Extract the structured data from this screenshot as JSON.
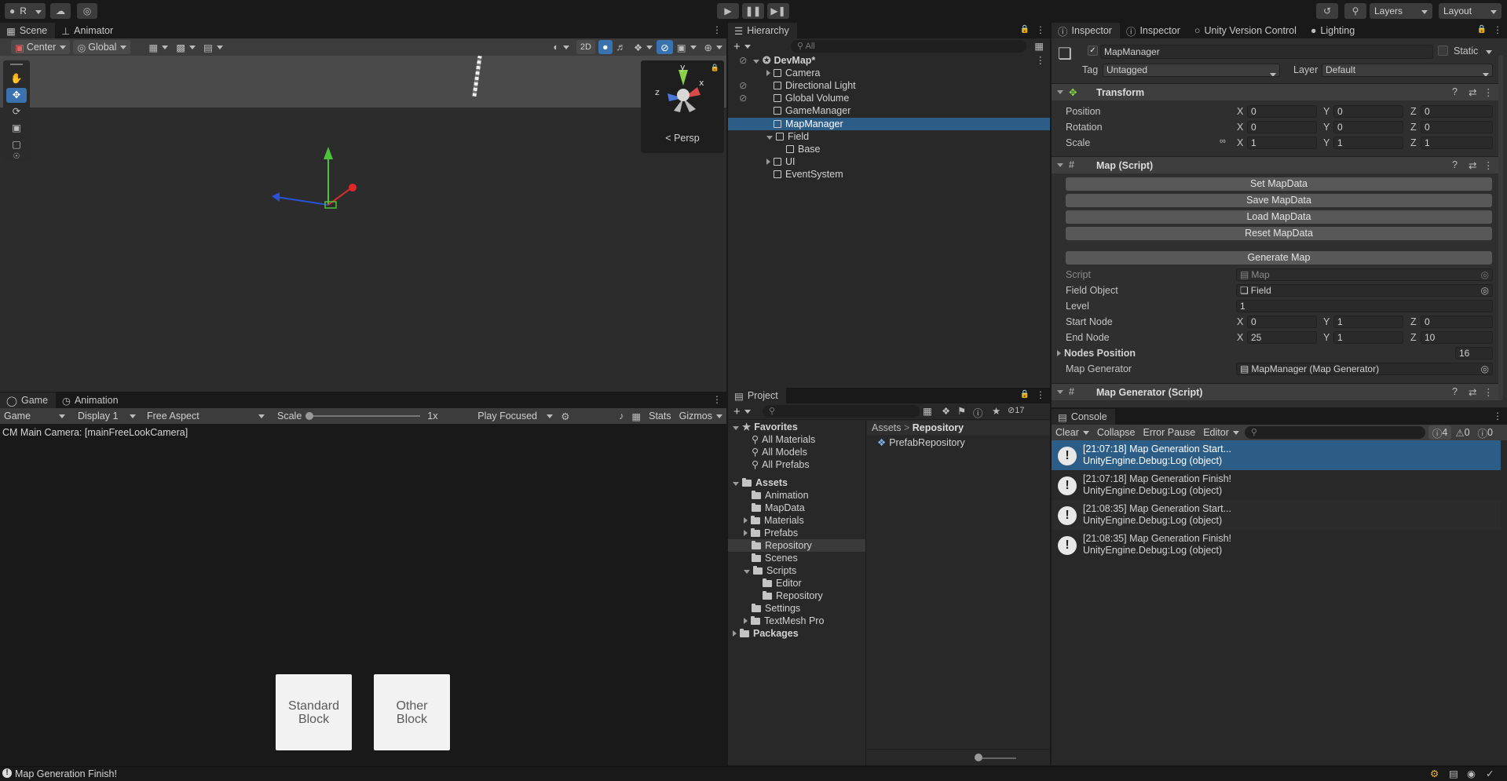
{
  "topbar": {
    "account_label": "R",
    "layers_label": "Layers",
    "layout_label": "Layout"
  },
  "scene": {
    "tabs": [
      "Scene",
      "Animator"
    ],
    "pivot_label": "Center",
    "space_label": "Global",
    "mode_2d_label": "2D",
    "persp_label": "Persp",
    "gizmo_axes": {
      "y": "y",
      "x": "x",
      "z": "z"
    }
  },
  "game": {
    "tabs": [
      "Game",
      "Animation"
    ],
    "display_mode": "Game",
    "display": "Display 1",
    "aspect": "Free Aspect",
    "scale_label": "Scale",
    "scale_value": "1x",
    "play_mode": "Play Focused",
    "stats_label": "Stats",
    "gizmos_label": "Gizmos",
    "camera_text": "CM Main Camera: [mainFreeLookCamera]",
    "blocks": [
      {
        "line1": "Standard",
        "line2": "Block"
      },
      {
        "line1": "Other",
        "line2": "Block"
      }
    ]
  },
  "hierarchy": {
    "title": "Hierarchy",
    "search_placeholder": "All",
    "scene_name": "DevMap*",
    "items": [
      {
        "label": "Camera",
        "expandable": true
      },
      {
        "label": "Directional Light",
        "expandable": false
      },
      {
        "label": "Global Volume",
        "expandable": false
      },
      {
        "label": "GameManager",
        "expandable": false
      },
      {
        "label": "MapManager",
        "expandable": false,
        "selected": true
      },
      {
        "label": "Field",
        "expandable": true,
        "expanded": true
      },
      {
        "label": "Base",
        "expandable": false,
        "child": true
      },
      {
        "label": "UI",
        "expandable": true
      },
      {
        "label": "EventSystem",
        "expandable": false
      }
    ]
  },
  "project": {
    "title": "Project",
    "hidden_count": "17",
    "favorites_label": "Favorites",
    "favorites": [
      "All Materials",
      "All Models",
      "All Prefabs"
    ],
    "assets_label": "Assets",
    "assets": [
      {
        "label": "Animation",
        "indent": 1,
        "expandable": false
      },
      {
        "label": "MapData",
        "indent": 1,
        "expandable": false
      },
      {
        "label": "Materials",
        "indent": 1,
        "expandable": true
      },
      {
        "label": "Prefabs",
        "indent": 1,
        "expandable": true
      },
      {
        "label": "Repository",
        "indent": 1,
        "expandable": false,
        "selected": true
      },
      {
        "label": "Scenes",
        "indent": 1,
        "expandable": false
      },
      {
        "label": "Scripts",
        "indent": 1,
        "expandable": true,
        "expanded": true
      },
      {
        "label": "Editor",
        "indent": 2,
        "expandable": false
      },
      {
        "label": "Repository",
        "indent": 2,
        "expandable": false
      },
      {
        "label": "Settings",
        "indent": 1,
        "expandable": false
      },
      {
        "label": "TextMesh Pro",
        "indent": 1,
        "expandable": true
      }
    ],
    "packages_label": "Packages",
    "breadcrumb": [
      "Assets",
      "Repository"
    ],
    "files": [
      "PrefabRepository"
    ]
  },
  "inspector": {
    "tabs": [
      "Inspector",
      "Inspector",
      "Unity Version Control",
      "Lighting"
    ],
    "object_name": "MapManager",
    "static_label": "Static",
    "tag_label": "Tag",
    "tag_value": "Untagged",
    "layer_label": "Layer",
    "layer_value": "Default",
    "transform": {
      "title": "Transform",
      "rows": [
        {
          "label": "Position",
          "x": "0",
          "y": "0",
          "z": "0"
        },
        {
          "label": "Rotation",
          "x": "0",
          "y": "0",
          "z": "0"
        },
        {
          "label": "Scale",
          "x": "1",
          "y": "1",
          "z": "1"
        }
      ]
    },
    "map_script": {
      "title": "Map (Script)",
      "buttons": [
        "Set MapData",
        "Save MapData",
        "Load MapData",
        "Reset MapData"
      ],
      "generate_button": "Generate Map",
      "script_label": "Script",
      "script_value": "Map",
      "field_object_label": "Field Object",
      "field_object_value": "Field",
      "level_label": "Level",
      "level_value": "1",
      "start_node_label": "Start Node",
      "start_node": {
        "x": "0",
        "y": "1",
        "z": "0"
      },
      "end_node_label": "End Node",
      "end_node": {
        "x": "25",
        "y": "1",
        "z": "10"
      },
      "nodes_position_label": "Nodes Position",
      "nodes_position_count": "16",
      "map_generator_label": "Map Generator",
      "map_generator_value": "MapManager (Map Generator)"
    },
    "map_generator_section": "Map Generator (Script)",
    "axis": {
      "x": "X",
      "y": "Y",
      "z": "Z"
    }
  },
  "console": {
    "title": "Console",
    "clear_label": "Clear",
    "collapse_label": "Collapse",
    "error_pause_label": "Error Pause",
    "editor_label": "Editor",
    "log_count": "4",
    "warn_count": "0",
    "error_count": "0",
    "entries": [
      {
        "line1": "[21:07:18] Map Generation Start...",
        "line2": "UnityEngine.Debug:Log (object)",
        "selected": true
      },
      {
        "line1": "[21:07:18] Map Generation Finish!",
        "line2": "UnityEngine.Debug:Log (object)",
        "selected": false
      },
      {
        "line1": "[21:08:35] Map Generation Start...",
        "line2": "UnityEngine.Debug:Log (object)",
        "selected": false
      },
      {
        "line1": "[21:08:35] Map Generation Finish!",
        "line2": "UnityEngine.Debug:Log (object)",
        "selected": false
      }
    ]
  },
  "statusbar": {
    "message": "Map Generation Finish!"
  },
  "colors": {
    "selection": "#2c5d87",
    "accent_blue": "#3a72b0",
    "panel": "#282828",
    "toolbar": "#3c3c3c"
  }
}
